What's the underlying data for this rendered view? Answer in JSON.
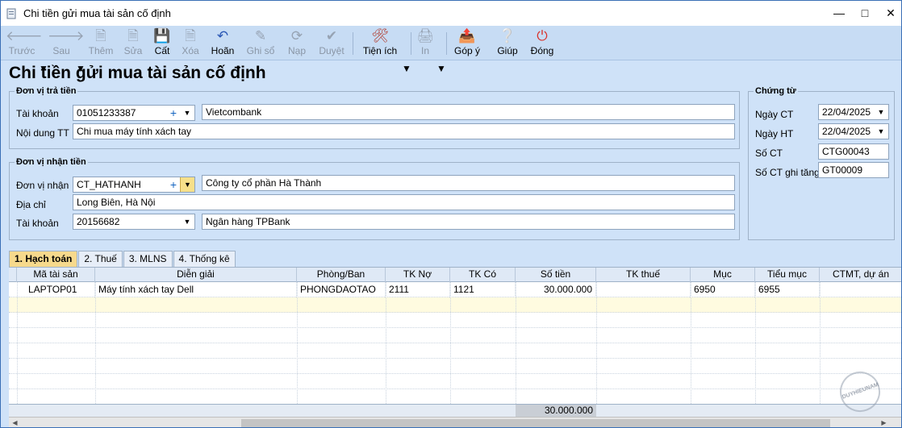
{
  "window": {
    "title": "Chi tiền gửi mua tài sản cố định"
  },
  "toolbar": {
    "back": "Trước",
    "next": "Sau",
    "add": "Thêm",
    "edit": "Sửa",
    "save": "Cất",
    "delete": "Xóa",
    "undo": "Hoãn",
    "post": "Ghi sổ",
    "load": "Nạp",
    "approve": "Duyệt",
    "utilities": "Tiện ích",
    "print": "In",
    "feedback": "Góp ý",
    "help": "Giúp",
    "close": "Đóng"
  },
  "page": {
    "heading": "Chi tiền gửi mua tài sản cố định"
  },
  "payer": {
    "legend": "Đơn vị trả tiền",
    "account_label": "Tài khoản",
    "account_value": "01051233387",
    "bank_name": "Vietcombank",
    "content_label": "Nội dung TT",
    "content_value": "Chi mua máy tính xách tay"
  },
  "receiver": {
    "legend": "Đơn vị nhận tiền",
    "unit_label": "Đơn vị nhận",
    "unit_value": "CT_HATHANH",
    "unit_name": "Công ty cổ phần Hà Thành",
    "address_label": "Địa chỉ",
    "address_value": "Long Biên, Hà Nội",
    "account_label": "Tài khoản",
    "account_value": "20156682",
    "bank_name": "Ngân hàng TPBank"
  },
  "voucher": {
    "legend": "Chứng từ",
    "date_ct_label": "Ngày CT",
    "date_ct_value": "22/04/2025",
    "date_ht_label": "Ngày HT",
    "date_ht_value": "22/04/2025",
    "no_label": "Số CT",
    "no_value": "CTG00043",
    "inc_label": "Số CT ghi tăng",
    "inc_value": "GT00009"
  },
  "tabs": [
    {
      "label": "1. Hạch toán"
    },
    {
      "label": "2. Thuế"
    },
    {
      "label": "3. MLNS"
    },
    {
      "label": "4. Thống kê"
    }
  ],
  "grid": {
    "headers": [
      "Mã tài sản",
      "Diễn giải",
      "Phòng/Ban",
      "TK Nợ",
      "TK Có",
      "Số tiền",
      "TK thuế",
      "Mục",
      "Tiểu mục",
      "CTMT, dự án"
    ],
    "rows": [
      [
        "LAPTOP01",
        "Máy tính xách tay Dell",
        "PHONGDAOTAO",
        "2111",
        "1121",
        "30.000.000",
        "",
        "6950",
        "6955",
        ""
      ]
    ],
    "total": "30.000.000"
  },
  "watermark": "DUYHIEUNAM"
}
